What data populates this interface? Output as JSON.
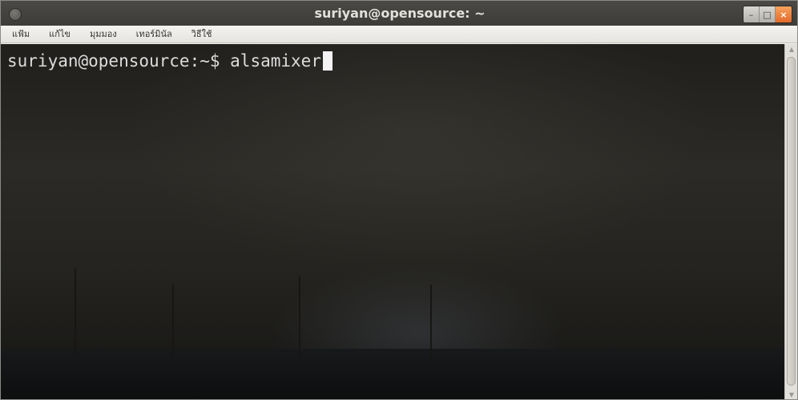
{
  "window": {
    "title": "suriyan@opensource: ~",
    "controls": {
      "minimize": "–",
      "maximize": "□",
      "close": "×"
    }
  },
  "menubar": {
    "items": [
      "แฟ้ม",
      "แก้ไข",
      "มุมมอง",
      "เทอร์มินัล",
      "วิธีใช้"
    ]
  },
  "terminal": {
    "prompt": "suriyan@opensource:~$ ",
    "command": "alsamixer"
  },
  "scrollbar": {
    "up": "▲",
    "down": "▼"
  },
  "colors": {
    "titlebar": "#3d3c38",
    "close_button": "#e4692a",
    "terminal_text": "#dcdcdc"
  }
}
